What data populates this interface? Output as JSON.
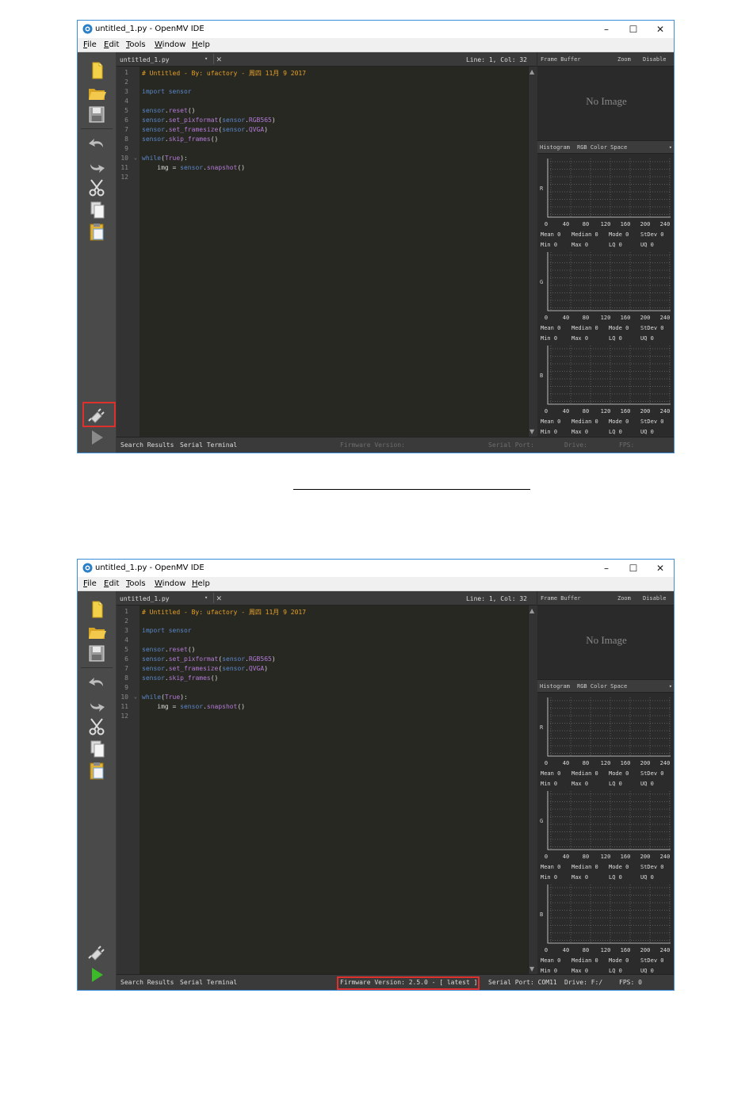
{
  "windows": [
    {
      "title": "untitled_1.py - OpenMV IDE",
      "menu": [
        "File",
        "Edit",
        "Tools",
        "Window",
        "Help"
      ],
      "tab": {
        "filename": "untitled_1.py",
        "dropdown": "▾",
        "close": "✕",
        "position": "Line: 1, Col: 32"
      },
      "frame_buffer": {
        "label": "Frame Buffer",
        "zoom": "Zoom",
        "disable": "Disable",
        "no_image": "No Image"
      },
      "histogram": {
        "label": "Histogram",
        "space": "RGB Color Space",
        "channels": [
          "R",
          "G",
          "B"
        ]
      },
      "status": {
        "tab1": "Search Results",
        "tab2": "Serial Terminal",
        "firmware": "Firmware Version:",
        "serial_port": "Serial Port:",
        "drive": "Drive:",
        "fps": "FPS:"
      },
      "connected": false,
      "highlight": "connect-button"
    },
    {
      "title": "untitled_1.py - OpenMV IDE",
      "menu": [
        "File",
        "Edit",
        "Tools",
        "Window",
        "Help"
      ],
      "tab": {
        "filename": "untitled_1.py",
        "dropdown": "▾",
        "close": "✕",
        "position": "Line: 1, Col: 32"
      },
      "frame_buffer": {
        "label": "Frame Buffer",
        "zoom": "Zoom",
        "disable": "Disable",
        "no_image": "No Image"
      },
      "histogram": {
        "label": "Histogram",
        "space": "RGB Color Space",
        "channels": [
          "R",
          "G",
          "B"
        ]
      },
      "status": {
        "tab1": "Search Results",
        "tab2": "Serial Terminal",
        "firmware": "Firmware Version: 2.5.0 - [ latest ]",
        "serial_port": "Serial Port: COM11",
        "drive": "Drive: F:/",
        "fps": "FPS: 0"
      },
      "connected": true,
      "highlight": "firmware-version"
    }
  ],
  "window_controls": {
    "minimize": "–",
    "maximize": "☐",
    "close": "✕"
  },
  "code_lines": [
    [
      {
        "t": "# Untitled - By: ufactory - 周四 11月 9 2017",
        "c": "cm"
      }
    ],
    [],
    [
      {
        "t": "import ",
        "c": "kw"
      },
      {
        "t": "sensor",
        "c": "kw"
      }
    ],
    [],
    [
      {
        "t": "sensor",
        "c": "kw"
      },
      {
        "t": ".",
        "c": "tx"
      },
      {
        "t": "reset",
        "c": "fn"
      },
      {
        "t": "()",
        "c": "tx"
      }
    ],
    [
      {
        "t": "sensor",
        "c": "kw"
      },
      {
        "t": ".",
        "c": "tx"
      },
      {
        "t": "set_pixformat",
        "c": "fn"
      },
      {
        "t": "(",
        "c": "tx"
      },
      {
        "t": "sensor",
        "c": "kw"
      },
      {
        "t": ".",
        "c": "tx"
      },
      {
        "t": "RGB565",
        "c": "fn"
      },
      {
        "t": ")",
        "c": "tx"
      }
    ],
    [
      {
        "t": "sensor",
        "c": "kw"
      },
      {
        "t": ".",
        "c": "tx"
      },
      {
        "t": "set_framesize",
        "c": "fn"
      },
      {
        "t": "(",
        "c": "tx"
      },
      {
        "t": "sensor",
        "c": "kw"
      },
      {
        "t": ".",
        "c": "tx"
      },
      {
        "t": "QVGA",
        "c": "fn"
      },
      {
        "t": ")",
        "c": "tx"
      }
    ],
    [
      {
        "t": "sensor",
        "c": "kw"
      },
      {
        "t": ".",
        "c": "tx"
      },
      {
        "t": "skip_frames",
        "c": "fn"
      },
      {
        "t": "()",
        "c": "tx"
      }
    ],
    [],
    [
      {
        "t": "while",
        "c": "kw"
      },
      {
        "t": "(",
        "c": "tx"
      },
      {
        "t": "True",
        "c": "fn"
      },
      {
        "t": "):",
        "c": "tx"
      }
    ],
    [
      {
        "t": "    img ",
        "c": "tx"
      },
      {
        "t": "= ",
        "c": "tx"
      },
      {
        "t": "sensor",
        "c": "kw"
      },
      {
        "t": ".",
        "c": "tx"
      },
      {
        "t": "snapshot",
        "c": "fn"
      },
      {
        "t": "()",
        "c": "tx"
      }
    ],
    []
  ],
  "line_numbers": [
    "1",
    "2",
    "3",
    "4",
    "5",
    "6",
    "7",
    "8",
    "9",
    "10",
    "11",
    "12"
  ],
  "hist_ticks": [
    "0",
    "40",
    "80",
    "120",
    "160",
    "200",
    "240"
  ],
  "hist_stats": {
    "row1": [
      "Mean 0",
      "Median 0",
      "Mode 0",
      "StDev 0"
    ],
    "row2": [
      "Min  0",
      "Max   0",
      "LQ  0",
      "UQ  0"
    ]
  },
  "colors": {
    "editor_bg": "#272822",
    "comment": "#e6a028",
    "keyword": "#5b87c7",
    "function": "#b37ad6",
    "highlight": "#e0302e",
    "play_active": "#3cba2a",
    "play_inactive": "#8a8a8a"
  }
}
